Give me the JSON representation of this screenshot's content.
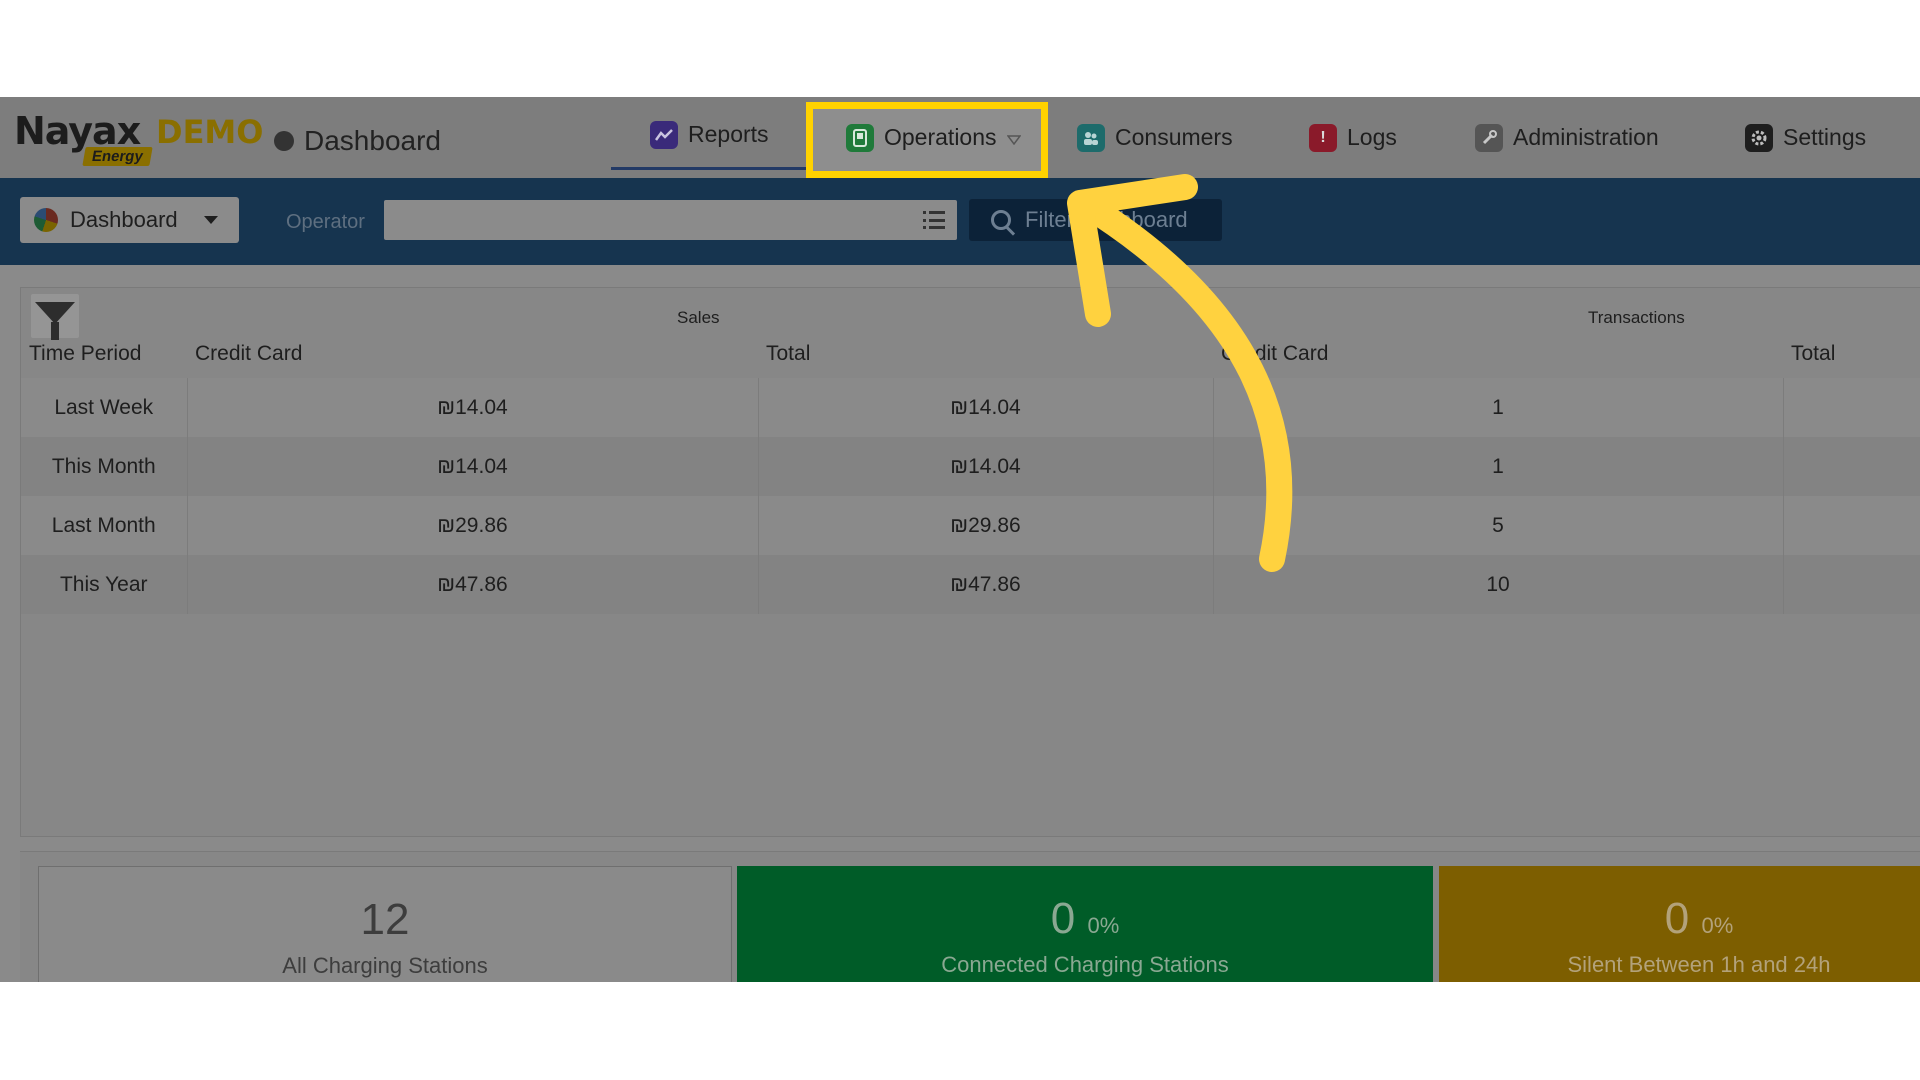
{
  "header": {
    "logo_brand": "Nayax",
    "logo_demo": "DEMO",
    "logo_sub": "Energy",
    "page_title": "Dashboard",
    "nav": [
      {
        "label": "Reports",
        "icon": "chart-icon",
        "color": "#3a2a7a"
      },
      {
        "label": "Operations",
        "icon": "operations-icon",
        "color": "#1f7a3a"
      },
      {
        "label": "Consumers",
        "icon": "consumers-icon",
        "color": "#1d6b6b"
      },
      {
        "label": "Logs",
        "icon": "alert-icon",
        "color": "#8a1a2a"
      },
      {
        "label": "Administration",
        "icon": "wrench-icon",
        "color": "#555555"
      },
      {
        "label": "Settings",
        "icon": "gear-icon",
        "color": "#1e1e1e"
      }
    ]
  },
  "filterbar": {
    "dashboard_select": "Dashboard",
    "operator_label": "Operator",
    "operator_value": "",
    "filter_button": "Filter Dashboard"
  },
  "table": {
    "group_sales": "Sales",
    "group_transactions": "Transactions",
    "columns": [
      "Time Period",
      "Credit Card",
      "Total",
      "Credit Card",
      "Total"
    ],
    "rows": [
      {
        "period": "Last Week",
        "sales_cc": "₪14.04",
        "sales_total": "₪14.04",
        "tx_cc": "1",
        "tx_total": ""
      },
      {
        "period": "This Month",
        "sales_cc": "₪14.04",
        "sales_total": "₪14.04",
        "tx_cc": "1",
        "tx_total": ""
      },
      {
        "period": "Last Month",
        "sales_cc": "₪29.86",
        "sales_total": "₪29.86",
        "tx_cc": "5",
        "tx_total": ""
      },
      {
        "period": "This Year",
        "sales_cc": "₪47.86",
        "sales_total": "₪47.86",
        "tx_cc": "10",
        "tx_total": ""
      }
    ]
  },
  "cards": {
    "all": {
      "value": "12",
      "caption": "All Charging Stations"
    },
    "connected": {
      "value": "0",
      "percent": "0%",
      "caption": "Connected Charging Stations"
    },
    "silent": {
      "value": "0",
      "percent": "0%",
      "caption": "Silent Between 1h and 24h"
    }
  },
  "colors": {
    "highlight": "#ffd200",
    "arrow": "#ffd23f",
    "filterbar": "#16344f",
    "connected_card": "#005c28",
    "silent_card": "#7d5e00"
  }
}
